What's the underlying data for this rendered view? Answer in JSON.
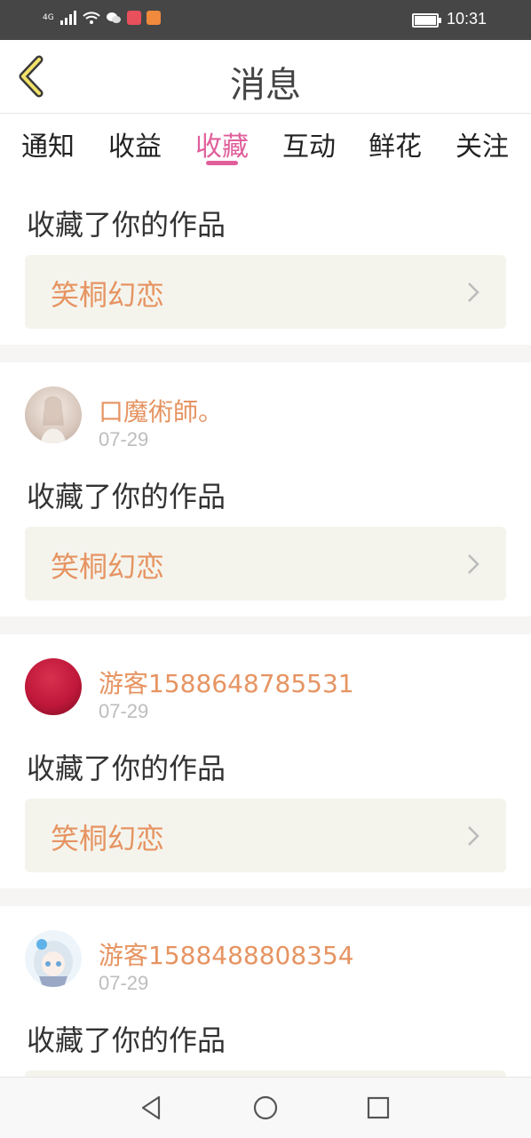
{
  "status": {
    "network": "4G",
    "time": "10:31"
  },
  "header": {
    "title": "消息",
    "back_icon": "chevron-left-icon"
  },
  "tabs": [
    {
      "label": "通知",
      "active": false
    },
    {
      "label": "收益",
      "active": false
    },
    {
      "label": "收藏",
      "active": true
    },
    {
      "label": "互动",
      "active": false
    },
    {
      "label": "鲜花",
      "active": false
    },
    {
      "label": "关注",
      "active": false
    }
  ],
  "items": [
    {
      "message": "收藏了你的作品",
      "work": "笑桐幻恋"
    },
    {
      "user": "口魔術師。",
      "date": "07-29",
      "message": "收藏了你的作品",
      "work": "笑桐幻恋"
    },
    {
      "user": "游客1588648785531",
      "date": "07-29",
      "message": "收藏了你的作品",
      "work": "笑桐幻恋"
    },
    {
      "user": "游客1588488808354",
      "date": "07-29",
      "message": "收藏了你的作品"
    }
  ],
  "colors": {
    "accent": "#e05f9b",
    "username": "#e69462",
    "work_bg": "#f4f4ed"
  }
}
